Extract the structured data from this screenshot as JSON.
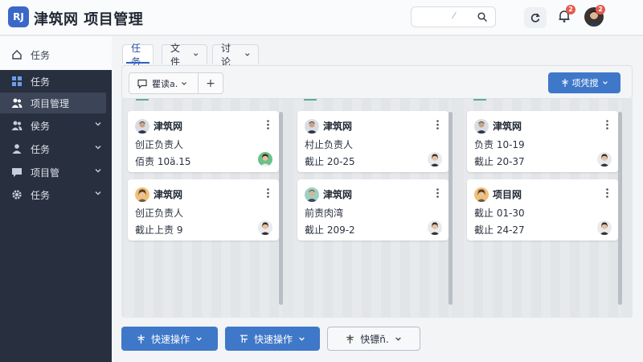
{
  "app": {
    "logo_text": "RJ",
    "title": "津筑网  项目管理"
  },
  "search": {
    "placeholder": "⁄"
  },
  "header": {
    "notifications_badge": "2",
    "avatar_badge": "2"
  },
  "sidebar": {
    "items": [
      {
        "label": "任务",
        "icon": "home-icon"
      },
      {
        "label": "任务",
        "icon": "dashboard-icon"
      },
      {
        "label": "项目管理",
        "icon": "users-icon",
        "active": true
      },
      {
        "label": "侯务",
        "icon": "users-icon",
        "expandable": true
      },
      {
        "label": "任务",
        "icon": "user-icon",
        "expandable": true
      },
      {
        "label": "项目管",
        "icon": "message-icon",
        "expandable": true
      },
      {
        "label": "任务",
        "icon": "gear-icon",
        "expandable": true
      }
    ]
  },
  "tabs": [
    {
      "label": "任务",
      "active": true
    },
    {
      "label": "文件"
    },
    {
      "label": "讨论"
    }
  ],
  "toolbar": {
    "filter_label": "瞿读a.",
    "add_label": "+",
    "action_label": "项凭搅"
  },
  "columns": [
    {
      "cards": [
        {
          "name": "津筑网",
          "line1": "创正负责人",
          "line2": "佰责 10ä.15"
        },
        {
          "name": "津筑网",
          "line1": "创正负责人",
          "line2": "截止上责 9"
        }
      ]
    },
    {
      "cards": [
        {
          "name": "津筑网",
          "line1": "村止负责人",
          "line2": "截止 20-25"
        },
        {
          "name": "津筑网",
          "line1": "前责肉湾",
          "line2": "截止 209-2"
        }
      ]
    },
    {
      "cards": [
        {
          "name": "津筑网",
          "line1": "负责 10-19",
          "line2": "截止 20-37"
        },
        {
          "name": "项目网",
          "line1": "截止 01-30",
          "line2": "截止 24-27"
        }
      ]
    }
  ],
  "bottom_actions": [
    {
      "label": "快速操作"
    },
    {
      "label": "快速操作"
    },
    {
      "label": "快镖ñ."
    }
  ],
  "colors": {
    "sidebar_bg": "#283040",
    "accent": "#3f78c9",
    "badge": "#e25b4e"
  }
}
